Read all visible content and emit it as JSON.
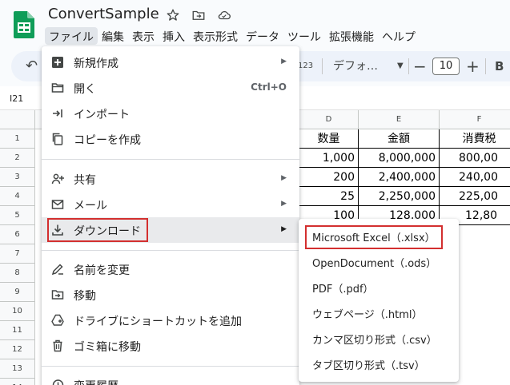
{
  "doc": {
    "title": "ConvertSample"
  },
  "menubar": [
    "ファイル",
    "編集",
    "表示",
    "挿入",
    "表示形式",
    "データ",
    "ツール",
    "拡張機能",
    "ヘルプ"
  ],
  "toolbar": {
    "format_123": "123",
    "font": "デフォ…",
    "font_size": "10",
    "minus": "−",
    "plus": "+",
    "bold": "B"
  },
  "namebox": "I21",
  "columns": [
    "D",
    "E",
    "F"
  ],
  "rows": [
    "1",
    "2",
    "3",
    "4",
    "5",
    "6",
    "7",
    "8",
    "9",
    "10",
    "11",
    "12",
    "13",
    "14",
    "15"
  ],
  "sheet": {
    "headers": [
      "数量",
      "金額",
      "消費税"
    ],
    "data": [
      [
        "1,000",
        "8,000,000",
        "800,00"
      ],
      [
        "200",
        "2,400,000",
        "240,00"
      ],
      [
        "25",
        "2,250,000",
        "225,00"
      ],
      [
        "100",
        "128,000",
        "12,80"
      ]
    ]
  },
  "file_menu": {
    "new": "新規作成",
    "open": "開く",
    "open_shortcut": "Ctrl+O",
    "import": "インポート",
    "copy": "コピーを作成",
    "share": "共有",
    "email": "メール",
    "download": "ダウンロード",
    "rename": "名前を変更",
    "move": "移動",
    "shortcut": "ドライブにショートカットを追加",
    "trash": "ゴミ箱に移動",
    "history": "変更履歴"
  },
  "download_menu": [
    "Microsoft Excel（.xlsx）",
    "OpenDocument（.ods）",
    "PDF（.pdf）",
    "ウェブページ（.html）",
    "カンマ区切り形式（.csv）",
    "タブ区切り形式（.tsv）"
  ],
  "colors": {
    "highlight": "#d32f2f",
    "sheets_green": "#0f9d58",
    "menu_hover": "#e9eaec"
  }
}
